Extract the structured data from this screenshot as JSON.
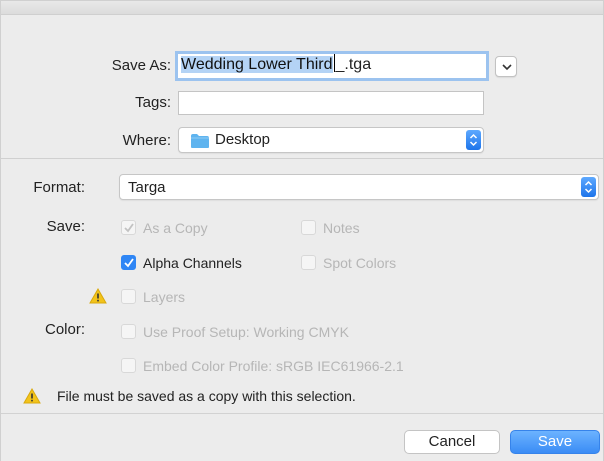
{
  "save_as": {
    "label": "Save As:",
    "filename_selected": "Wedding Lower Third",
    "filename_rest": "_.tga"
  },
  "tags": {
    "label": "Tags:",
    "value": ""
  },
  "where": {
    "label": "Where:",
    "value": "Desktop",
    "icon": "folder-icon"
  },
  "format": {
    "label": "Format:",
    "value": "Targa"
  },
  "save_options": {
    "label": "Save:",
    "as_a_copy": {
      "label": "As a Copy",
      "checked": true,
      "enabled": false
    },
    "notes": {
      "label": "Notes",
      "checked": false,
      "enabled": false
    },
    "alpha_channels": {
      "label": "Alpha Channels",
      "checked": true,
      "enabled": true
    },
    "spot_colors": {
      "label": "Spot Colors",
      "checked": false,
      "enabled": false
    },
    "layers": {
      "label": "Layers",
      "checked": false,
      "enabled": false
    }
  },
  "color": {
    "label": "Color:",
    "use_proof_setup": {
      "label": "Use Proof Setup:  Working CMYK",
      "enabled": false
    },
    "embed_profile": {
      "label": "Embed Color Profile:  sRGB IEC61966-2.1",
      "enabled": false
    }
  },
  "warning_message": "File must be saved as a copy with this selection.",
  "buttons": {
    "cancel": "Cancel",
    "save": "Save"
  },
  "colors": {
    "accent": "#2f86f5",
    "warning": "#f2c31b",
    "selection": "#b4d3f5"
  }
}
